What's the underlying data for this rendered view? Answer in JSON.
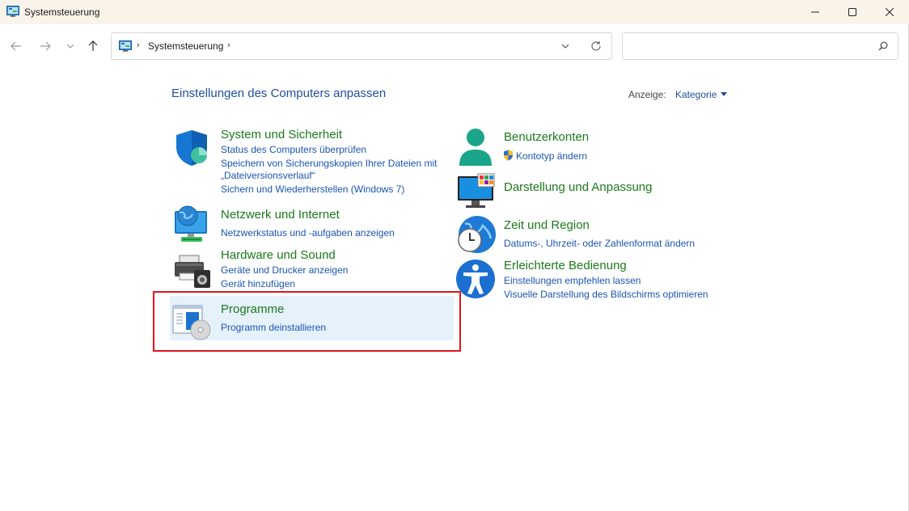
{
  "window": {
    "title": "Systemsteuerung"
  },
  "address_bar": {
    "breadcrumb": "Systemsteuerung",
    "separator": "›"
  },
  "search": {
    "placeholder": "",
    "value": ""
  },
  "content": {
    "heading": "Einstellungen des Computers anpassen",
    "view_label": "Anzeige:",
    "view_value": "Kategorie"
  },
  "categories": {
    "system": {
      "title": "System und Sicherheit",
      "links": [
        "Status des Computers überprüfen",
        "Speichern von Sicherungskopien Ihrer Dateien mit",
        "„Dateiversionsverlauf“",
        "Sichern und Wiederherstellen (Windows 7)"
      ]
    },
    "network": {
      "title": "Netzwerk und Internet",
      "links": [
        "Netzwerkstatus und -aufgaben anzeigen"
      ]
    },
    "hardware": {
      "title": "Hardware und Sound",
      "links": [
        "Geräte und Drucker anzeigen",
        "Gerät hinzufügen"
      ]
    },
    "programs": {
      "title": "Programme",
      "links": [
        "Programm deinstallieren"
      ]
    },
    "accounts": {
      "title": "Benutzerkonten",
      "links": [
        "Kontotyp ändern"
      ]
    },
    "appearance": {
      "title": "Darstellung und Anpassung",
      "links": []
    },
    "clock": {
      "title": "Zeit und Region",
      "links": [
        "Datums-, Uhrzeit- oder Zahlenformat ändern"
      ]
    },
    "ease": {
      "title": "Erleichterte Bedienung",
      "links": [
        "Einstellungen empfehlen lassen",
        "Visuelle Darstellung des Bildschirms optimieren"
      ]
    }
  },
  "colors": {
    "category_title": "#1b7a1b",
    "link": "#1a55b0",
    "heading": "#1e4e9c",
    "highlight_border": "#e0141e",
    "titlebar_bg": "#faf3ea"
  }
}
